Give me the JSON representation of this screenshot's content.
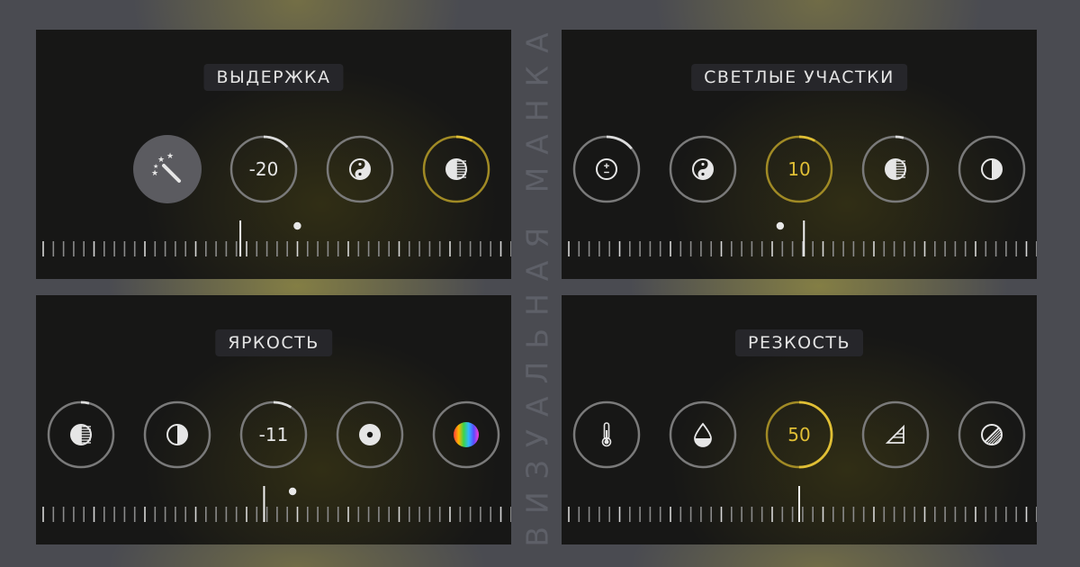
{
  "watermark": "ВИЗУАЛЬНАЯ МАНКА",
  "colors": {
    "accent": "#e0bf35",
    "ring": "#7a7a7a",
    "text": "#e6e6e6"
  },
  "panels": [
    {
      "title": "ВЫДЕРЖКА",
      "buttons": [
        {
          "name": "auto-enhance-button",
          "icon": "magic-wand-icon",
          "value": "",
          "style": "filled",
          "progress": 0
        },
        {
          "name": "exposure-dial",
          "icon": "",
          "value": "-20",
          "style": "normal",
          "progress": 0.13
        },
        {
          "name": "brilliance-button",
          "icon": "yin-yang-icon",
          "value": "",
          "style": "normal",
          "progress": 0
        },
        {
          "name": "highlights-button",
          "icon": "half-striped-circle-icon",
          "value": "",
          "style": "gold",
          "progress": 0.08
        }
      ]
    },
    {
      "title": "СВЕТЛЫЕ УЧАСТКИ",
      "buttons": [
        {
          "name": "exposure-button",
          "icon": "plus-minus-icon",
          "value": "",
          "style": "normal",
          "progress": 0.14
        },
        {
          "name": "brilliance-button",
          "icon": "yin-yang-icon",
          "value": "",
          "style": "normal",
          "progress": 0
        },
        {
          "name": "highlights-dial",
          "icon": "",
          "value": "10",
          "style": "gold",
          "progress": 0.08
        },
        {
          "name": "shadows-button",
          "icon": "half-striped-circle-icon",
          "value": "",
          "style": "normal",
          "progress": 0.04
        },
        {
          "name": "contrast-button",
          "icon": "half-circle-icon",
          "value": "",
          "style": "normal",
          "progress": 0
        }
      ]
    },
    {
      "title": "ЯРКОСТЬ",
      "buttons": [
        {
          "name": "shadows-button",
          "icon": "half-striped-circle-icon",
          "value": "",
          "style": "normal",
          "progress": 0.04
        },
        {
          "name": "contrast-button",
          "icon": "half-circle-icon",
          "value": "",
          "style": "normal",
          "progress": 0
        },
        {
          "name": "brightness-dial",
          "icon": "",
          "value": "-11",
          "style": "normal",
          "progress": 0.09
        },
        {
          "name": "black-point-button",
          "icon": "dot-circle-icon",
          "value": "",
          "style": "normal",
          "progress": 0
        },
        {
          "name": "saturation-button",
          "icon": "color-wheel-icon",
          "value": "",
          "style": "normal",
          "progress": 0
        }
      ]
    },
    {
      "title": "РЕЗКОСТЬ",
      "buttons": [
        {
          "name": "warmth-button",
          "icon": "thermometer-icon",
          "value": "",
          "style": "normal",
          "progress": 0
        },
        {
          "name": "tint-button",
          "icon": "drop-icon",
          "value": "",
          "style": "normal",
          "progress": 0
        },
        {
          "name": "sharpness-dial",
          "icon": "",
          "value": "50",
          "style": "gold",
          "progress": 0.5
        },
        {
          "name": "definition-button",
          "icon": "triangle-icon",
          "value": "",
          "style": "normal",
          "progress": 0
        },
        {
          "name": "noise-reduction-button",
          "icon": "striped-diagonal-circle-icon",
          "value": "",
          "style": "normal",
          "progress": 0
        }
      ]
    }
  ],
  "sliders": [
    {
      "value": 0.43,
      "default_marker": 0.55
    },
    {
      "value": 0.51,
      "default_marker": 0.46
    },
    {
      "value": 0.48,
      "default_marker": 0.54
    },
    {
      "value": 0.5,
      "default_marker": null
    }
  ]
}
